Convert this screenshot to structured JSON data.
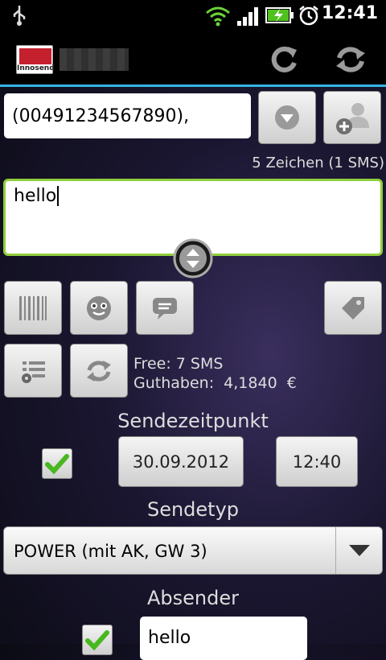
{
  "status": {
    "time": "12:41"
  },
  "app": {
    "logo_text": "Innosend"
  },
  "recipient": {
    "value": "(00491234567890),"
  },
  "counter": "5 Zeichen (1 SMS)",
  "message": {
    "value": "hello"
  },
  "account": {
    "free": "Free: 7 SMS",
    "balance": "Guthaben:  4,1840  €"
  },
  "schedule": {
    "title": "Sendezeitpunkt",
    "checked": true,
    "date": "30.09.2012",
    "time": "12:40"
  },
  "sendtype": {
    "title": "Sendetyp",
    "selected": "POWER (mit AK, GW 3)"
  },
  "sender": {
    "title": "Absender",
    "value": "hello"
  },
  "colors": {
    "accent": "#33b5e5",
    "message_border": "#8fce3b"
  }
}
